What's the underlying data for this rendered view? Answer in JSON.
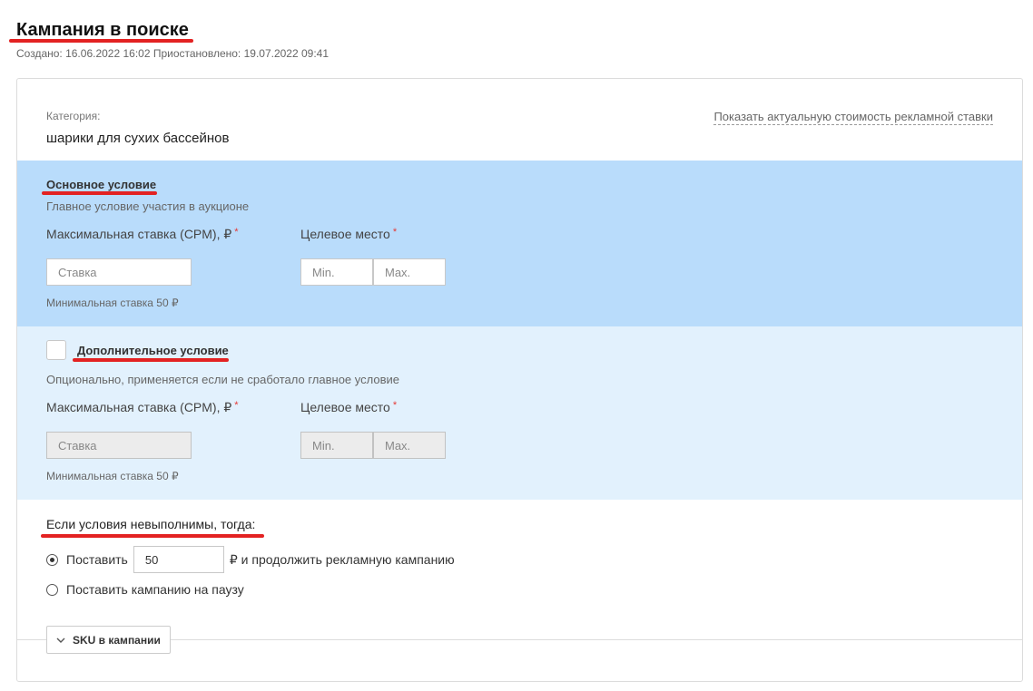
{
  "header": {
    "title": "Кампания в поиске",
    "meta": "Создано: 16.06.2022 16:02 Приостановлено: 19.07.2022 09:41"
  },
  "category": {
    "label": "Категория:",
    "value": "шарики для сухих бассейнов",
    "price_link": "Показать актуальную стоимость рекламной ставки"
  },
  "main_condition": {
    "title": "Основное условие",
    "subtitle": "Главное условие участия в аукционе",
    "bid_label": "Максимальная ставка (CPM), ₽",
    "place_label": "Целевое место",
    "required_mark": "*",
    "bid_placeholder": "Ставка",
    "min_placeholder": "Min.",
    "max_placeholder": "Max.",
    "hint": "Минимальная ставка 50 ₽"
  },
  "extra_condition": {
    "title": "Дополнительное условие",
    "subtitle": "Опционально, применяется если не сработало главное условие",
    "bid_label": "Максимальная ставка (CPM), ₽",
    "place_label": "Целевое место",
    "required_mark": "*",
    "bid_placeholder": "Ставка",
    "min_placeholder": "Min.",
    "max_placeholder": "Max.",
    "hint": "Минимальная ставка 50 ₽",
    "checked": false
  },
  "fallback": {
    "title": "Если условия невыполнимы, тогда:",
    "option1_prefix": "Поставить",
    "option1_value": "50",
    "option1_suffix": "₽ и продолжить рекламную кампанию",
    "option2_label": "Поставить кампанию на паузу",
    "selected": "option1"
  },
  "sku": {
    "button_label": "SKU в кампании",
    "icon": "chevron-down-icon"
  },
  "colors": {
    "main_bg": "#b9dcfb",
    "extra_bg": "#e2f1fd",
    "annotation_red": "#e32222",
    "required": "#e53935"
  }
}
